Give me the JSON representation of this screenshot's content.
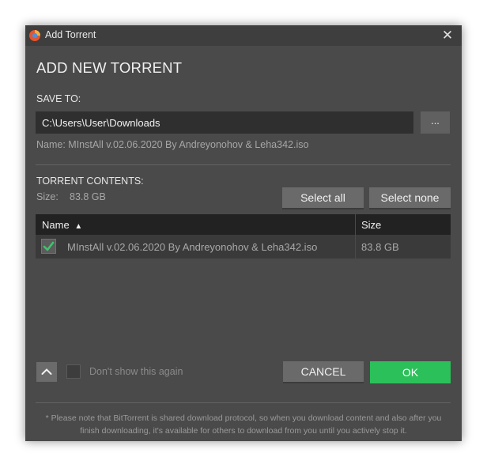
{
  "window": {
    "title": "Add Torrent",
    "close_glyph": "✕"
  },
  "heading": "ADD NEW TORRENT",
  "save_to": {
    "label": "SAVE TO:",
    "path": "C:\\Users\\User\\Downloads",
    "browse_label": "...",
    "name_line": "Name: MInstAll v.02.06.2020 By Andreyonohov & Leha342.iso"
  },
  "contents": {
    "label": "TORRENT CONTENTS:",
    "size_label": "Size:",
    "size_value": "83.8 GB",
    "select_all": "Select all",
    "select_none": "Select none",
    "columns": {
      "name": "Name",
      "sort_glyph": "▲",
      "size": "Size"
    },
    "files": [
      {
        "name": "MInstAll v.02.06.2020 By Andreyonohov & Leha342.iso",
        "size": "83.8 GB",
        "checked": true
      }
    ]
  },
  "footer": {
    "dont_show": "Don't show this again",
    "cancel": "CANCEL",
    "ok": "OK"
  },
  "note": "* Please note that BitTorrent is shared download protocol, so when you download content and also after you finish downloading, it's available for others to download from you until you actively stop it.",
  "colors": {
    "ok_green": "#2cc05a",
    "checkmark_green": "#3ec46d",
    "dialog_bg": "#4a4a4a"
  }
}
